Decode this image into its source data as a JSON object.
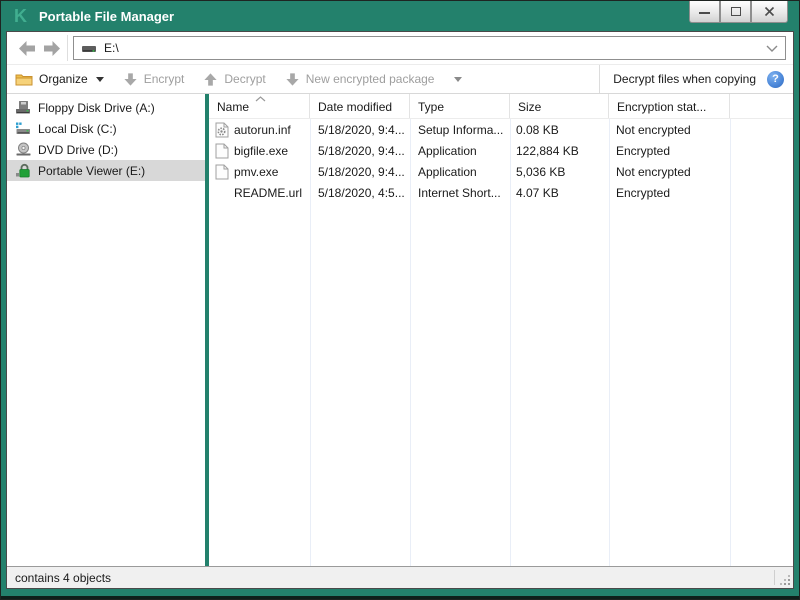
{
  "window": {
    "title": "Portable File Manager",
    "logo_letter": "K"
  },
  "navbar": {
    "address": "E:\\"
  },
  "toolbar": {
    "organize_label": "Organize",
    "encrypt_label": "Encrypt",
    "decrypt_label": "Decrypt",
    "new_package_label": "New encrypted package",
    "decrypt_copy_label": "Decrypt files when copying",
    "help_glyph": "?"
  },
  "sidebar": {
    "items": [
      {
        "label": "Floppy Disk Drive (A:)",
        "icon": "floppy-drive-icon",
        "selected": false
      },
      {
        "label": "Local Disk (C:)",
        "icon": "hard-disk-icon",
        "selected": false
      },
      {
        "label": "DVD Drive (D:)",
        "icon": "dvd-drive-icon",
        "selected": false
      },
      {
        "label": "Portable Viewer (E:)",
        "icon": "padlock-icon",
        "selected": true
      }
    ]
  },
  "filelist": {
    "columns": [
      {
        "label": "Name",
        "sorted": "asc"
      },
      {
        "label": "Date modified"
      },
      {
        "label": "Type"
      },
      {
        "label": "Size"
      },
      {
        "label": "Encryption stat..."
      }
    ],
    "rows": [
      {
        "icon": "setup-information-file-icon",
        "name": "autorun.inf",
        "date": "5/18/2020, 9:4...",
        "type": "Setup Informa...",
        "size": "0.08 KB",
        "status": "Not encrypted"
      },
      {
        "icon": "generic-file-icon",
        "name": "bigfile.exe",
        "date": "5/18/2020, 9:4...",
        "type": "Application",
        "size": "122,884 KB",
        "status": "Encrypted"
      },
      {
        "icon": "generic-file-icon",
        "name": "pmv.exe",
        "date": "5/18/2020, 9:4...",
        "type": "Application",
        "size": "5,036 KB",
        "status": "Not encrypted"
      },
      {
        "icon": "none",
        "name": "README.url",
        "date": "5/18/2020, 4:5...",
        "type": "Internet Short...",
        "size": "4.07 KB",
        "status": "Encrypted"
      }
    ]
  },
  "statusbar": {
    "text": "contains 4 objects"
  },
  "colors": {
    "titlebar_teal": "#23816C",
    "help_blue": "#4A86D8",
    "lock_green": "#21A038",
    "folder_yellow": "#EFC04B"
  }
}
